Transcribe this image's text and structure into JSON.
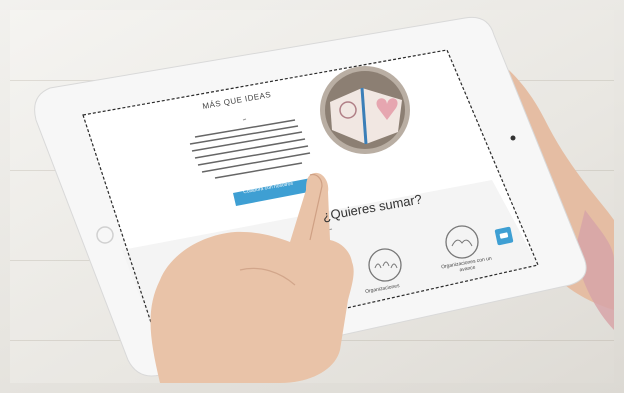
{
  "site": {
    "heading": "MÁS QUE IDEAS",
    "cta_button": "Colabora con nosotros",
    "section_heading": "¿Quieres sumar?",
    "cards": [
      {
        "label": "Organizaciones"
      },
      {
        "label": "Organizaciones con un avance"
      }
    ]
  },
  "colors": {
    "button": "#3e9fd3",
    "chat_badge": "#3e9fd3",
    "tablet_body": "#f7f7f7",
    "skin": "#e7c3aa"
  },
  "icons": [
    "heart-notebook-image",
    "people-group-icon",
    "hands-icon",
    "chat-icon"
  ]
}
